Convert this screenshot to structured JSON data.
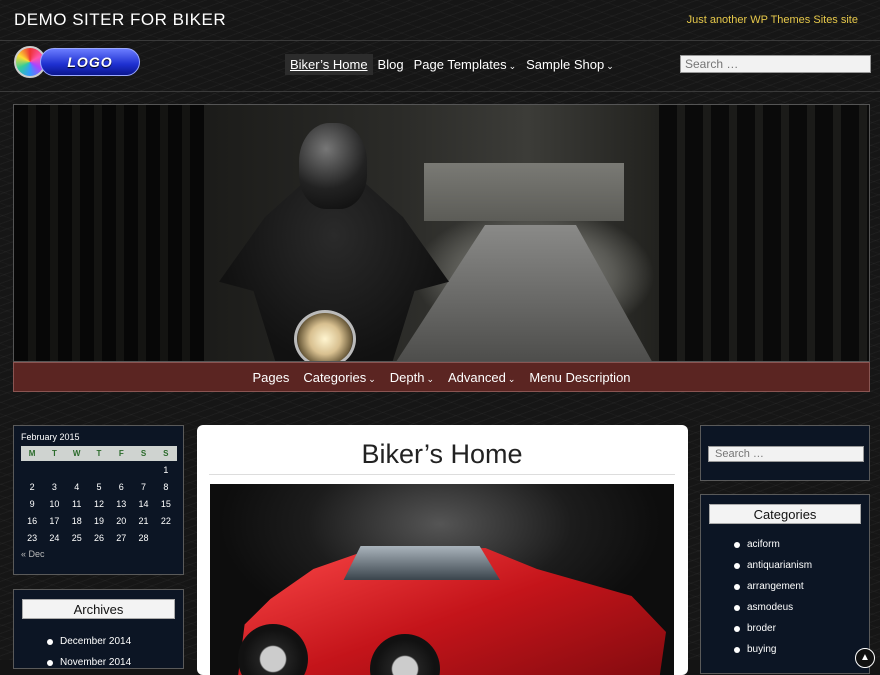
{
  "site": {
    "title": "DEMO SITER FOR BIKER",
    "tagline": "Just another WP Themes Sites site",
    "logo_text": "LOGO"
  },
  "nav": {
    "items": [
      {
        "label": "Biker’s Home",
        "active": true,
        "dropdown": false
      },
      {
        "label": "Blog",
        "active": false,
        "dropdown": false
      },
      {
        "label": "Page Templates",
        "active": false,
        "dropdown": true
      },
      {
        "label": "Sample Shop",
        "active": false,
        "dropdown": true
      }
    ],
    "search_placeholder": "Search …"
  },
  "hero_menu": {
    "items": [
      {
        "label": "Pages",
        "dropdown": false
      },
      {
        "label": "Categories",
        "dropdown": true
      },
      {
        "label": "Depth",
        "dropdown": true
      },
      {
        "label": "Advanced",
        "dropdown": true
      },
      {
        "label": "Menu Description",
        "dropdown": false
      }
    ]
  },
  "calendar": {
    "caption": "February 2015",
    "days": [
      "M",
      "T",
      "W",
      "T",
      "F",
      "S",
      "S"
    ],
    "weeks": [
      [
        "",
        "",
        "",
        "",
        "",
        "",
        "1"
      ],
      [
        "2",
        "3",
        "4",
        "5",
        "6",
        "7",
        "8"
      ],
      [
        "9",
        "10",
        "11",
        "12",
        "13",
        "14",
        "15"
      ],
      [
        "16",
        "17",
        "18",
        "19",
        "20",
        "21",
        "22"
      ],
      [
        "23",
        "24",
        "25",
        "26",
        "27",
        "28",
        ""
      ]
    ],
    "prev": "« Dec"
  },
  "archives": {
    "title": "Archives",
    "items": [
      "December 2014",
      "November 2014"
    ]
  },
  "page": {
    "title": "Biker’s Home"
  },
  "sidebar_search": {
    "placeholder": "Search …"
  },
  "categories": {
    "title": "Categories",
    "items": [
      "aciform",
      "antiquarianism",
      "arrangement",
      "asmodeus",
      "broder",
      "buying"
    ]
  },
  "dropdown_glyph": "⌄",
  "scroll_glyph": "▲"
}
